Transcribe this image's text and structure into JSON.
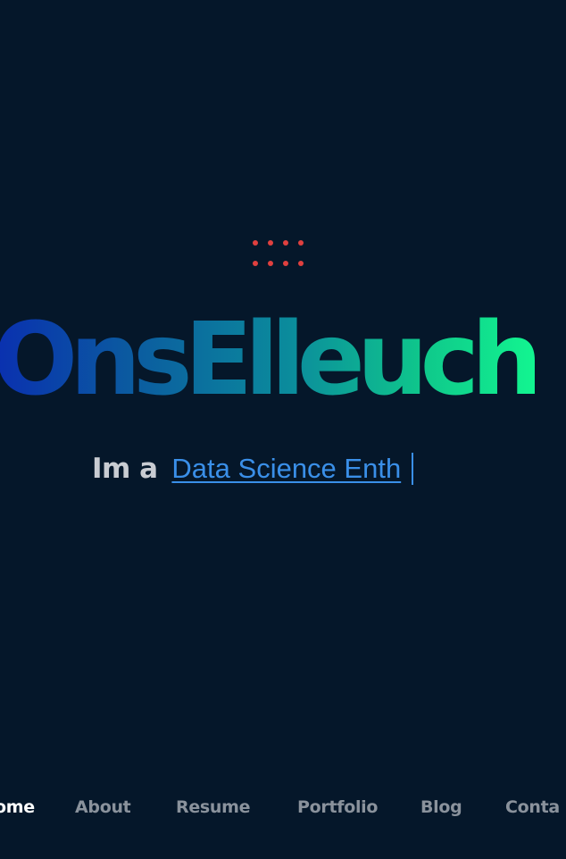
{
  "hero": {
    "name": "OnsElleuch",
    "tagline_prefix": "Im a",
    "tagline_typed": "Data Science Enth",
    "decoration_icon": "dot-grid-icon"
  },
  "nav": {
    "items": [
      {
        "label": "ome",
        "active": true
      },
      {
        "label": "About",
        "active": false
      },
      {
        "label": "Resume",
        "active": false
      },
      {
        "label": "Portfolio",
        "active": false
      },
      {
        "label": "Blog",
        "active": false
      },
      {
        "label": "Conta",
        "active": false
      }
    ]
  },
  "colors": {
    "background": "#05172a",
    "dots": "#e0403f",
    "name_gradient_start": "#0a2fb0",
    "name_gradient_end": "#12f590",
    "tagline_prefix": "#c9ccd2",
    "tagline_typed": "#3a8fe8",
    "caret": "#3a8fe8",
    "nav_active": "#ffffff",
    "nav_inactive": "#8a929c"
  }
}
